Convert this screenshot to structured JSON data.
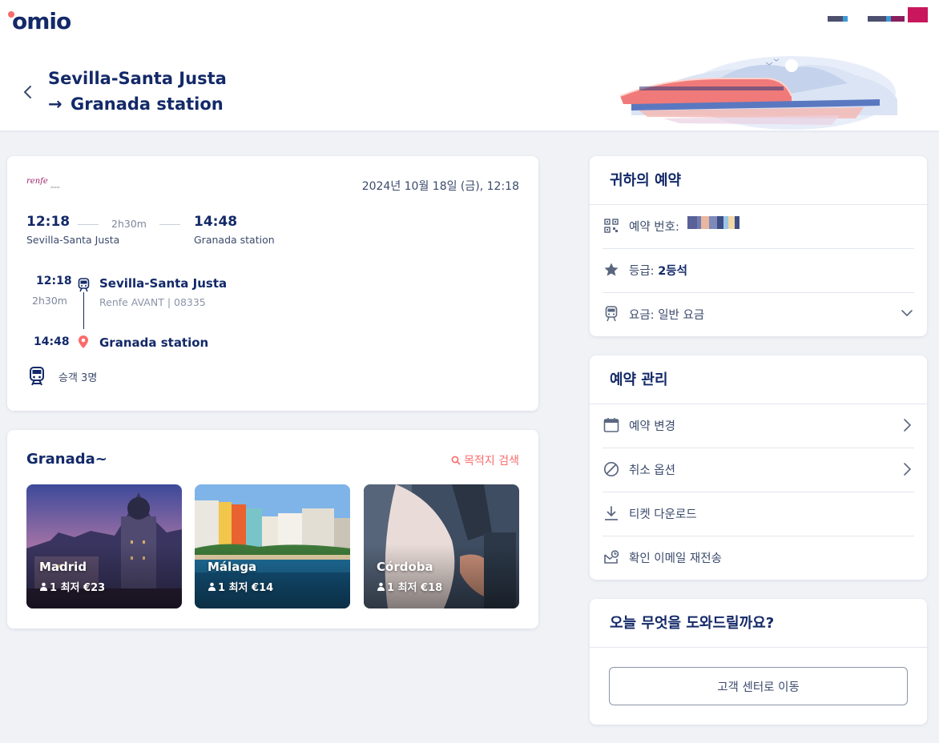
{
  "app": {
    "logo_text": "omio"
  },
  "header": {
    "title_line1": "Sevilla-Santa Justa",
    "title_arrow": "→",
    "title_line2": "Granada station"
  },
  "trip": {
    "operator_logo": "renfe",
    "operator_sublogo": "Avant",
    "date": "2024년 10월 18일 (금), 12:18",
    "departure_time": "12:18",
    "arrival_time": "14:48",
    "duration": "2h30m",
    "departure_station": "Sevilla-Santa Justa",
    "arrival_station": "Granada station",
    "segment": {
      "departure_time": "12:18",
      "duration": "2h30m",
      "arrival_time": "14:48",
      "from": "Sevilla-Santa Justa",
      "train_info": "Renfe AVANT | 08335",
      "to": "Granada station"
    },
    "passengers": "승객 3명"
  },
  "destinations": {
    "title": "Granada~",
    "search_label": "목적지 검색",
    "tiles": [
      {
        "name": "Madrid",
        "price": "1 최저 €23"
      },
      {
        "name": "Málaga",
        "price": "1 최저 €14"
      },
      {
        "name": "Córdoba",
        "price": "1 최저 €18"
      }
    ]
  },
  "reservation": {
    "title": "귀하의 예약",
    "booking_number_label": "예약 번호:",
    "class_label": "등급:",
    "class_value": "2등석",
    "fare_label": "요금:",
    "fare_value": "일반 요금"
  },
  "manage": {
    "title": "예약 관리",
    "items": [
      {
        "label": "예약 변경",
        "icon": "calendar-icon"
      },
      {
        "label": "취소 옵션",
        "icon": "cancel-icon"
      },
      {
        "label": "티켓 다운로드",
        "icon": "download-icon"
      },
      {
        "label": "확인 이메일 재전송",
        "icon": "email-resend-icon"
      }
    ]
  },
  "help": {
    "title": "오늘 무엇을 도와드릴까요?",
    "button_label": "고객 센터로 이동"
  },
  "colors": {
    "brand_navy": "#132968",
    "accent_coral": "#fa6b6b",
    "background": "#f1f2f6"
  }
}
